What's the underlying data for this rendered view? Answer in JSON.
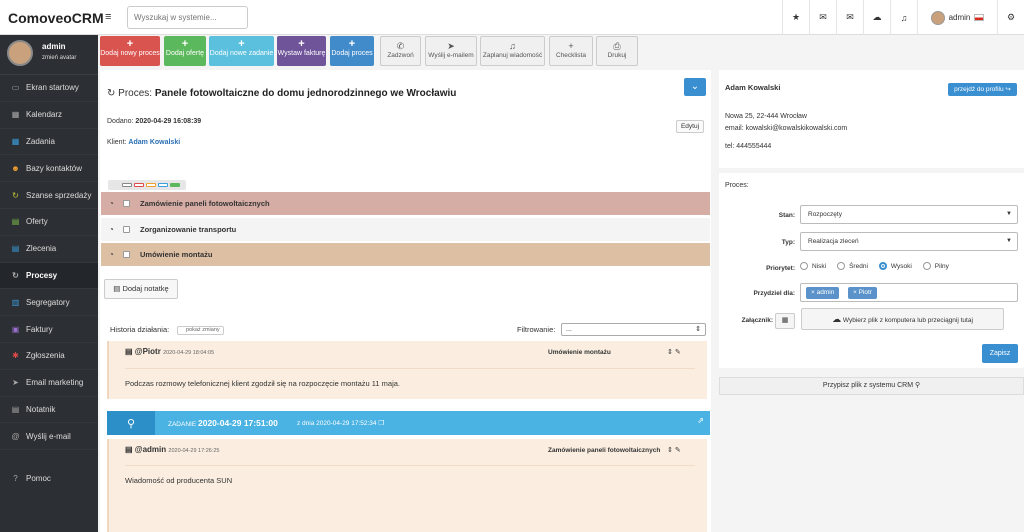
{
  "app": {
    "title": "ComoveoCRM",
    "menu_icon": "hamburger-icon"
  },
  "search": {
    "placeholder": "Wyszukaj w systemie..."
  },
  "topbar": {
    "icons": [
      "star-icon",
      "chat-icon",
      "mail-icon",
      "cloud-icon",
      "bell-icon"
    ],
    "user": "admin",
    "settings_icon": "gears-icon"
  },
  "sidebar": {
    "user_name": "admin",
    "change_avatar": "zmień avatar",
    "items": [
      {
        "label": "Ekran startowy",
        "icon": "monitor-icon",
        "glyph": "▭",
        "color": "w"
      },
      {
        "label": "Kalendarz",
        "icon": "calendar-icon",
        "glyph": "▦",
        "color": "w"
      },
      {
        "label": "Zadania",
        "icon": "tasks-icon",
        "glyph": "▦",
        "color": "b"
      },
      {
        "label": "Bazy kontaktów",
        "icon": "contacts-icon",
        "glyph": "☻",
        "color": "o"
      },
      {
        "label": "Szanse sprzedaży",
        "icon": "refresh-icon",
        "glyph": "↻",
        "color": "y"
      },
      {
        "label": "Oferty",
        "icon": "document-icon",
        "glyph": "▤",
        "color": "g"
      },
      {
        "label": "Zlecenia",
        "icon": "clipboard-icon",
        "glyph": "▤",
        "color": "b"
      },
      {
        "label": "Procesy",
        "icon": "process-icon",
        "glyph": "↻",
        "color": "w",
        "active": true
      },
      {
        "label": "Segregatory",
        "icon": "binder-icon",
        "glyph": "▥",
        "color": "b"
      },
      {
        "label": "Faktury",
        "icon": "invoice-icon",
        "glyph": "▣",
        "color": "p"
      },
      {
        "label": "Zgłoszenia",
        "icon": "ticket-icon",
        "glyph": "✱",
        "color": "r"
      },
      {
        "label": "Email marketing",
        "icon": "send-icon",
        "glyph": "➤",
        "color": "w"
      },
      {
        "label": "Notatnik",
        "icon": "notebook-icon",
        "glyph": "▤",
        "color": "w"
      },
      {
        "label": "Wyślij e-mail",
        "icon": "at-icon",
        "glyph": "@",
        "color": "w"
      }
    ],
    "help": "Pomoc"
  },
  "actions": {
    "colored": [
      {
        "label": "Dodaj nowy proces",
        "color": "#d9534f"
      },
      {
        "label": "Dodaj ofertę",
        "color": "#5cb85c"
      },
      {
        "label": "Dodaj nowe zadanie",
        "color": "#5bc0de"
      },
      {
        "label": "Wystaw fakturę",
        "color": "#6f5499"
      },
      {
        "label": "Dodaj proces",
        "color": "#428bca"
      }
    ],
    "gray": [
      {
        "label": "Zadzwoń",
        "icon": "phone-icon",
        "glyph": "✆"
      },
      {
        "label": "Wyślij e-mailem",
        "icon": "paper-plane-icon",
        "glyph": "➤"
      },
      {
        "label": "Zaplanuj wiadomość",
        "icon": "bell-icon",
        "glyph": "♫"
      },
      {
        "label": "Checklista",
        "icon": "plus-icon",
        "glyph": "+"
      },
      {
        "label": "Drukuj",
        "icon": "print-icon",
        "glyph": "⎙"
      }
    ]
  },
  "process": {
    "prefix": "Proces:",
    "name": "Panele fotowoltaiczne do domu jednorodzinnego we Wrocławiu",
    "added_label": "Dodano:",
    "added_value": "2020-04-29 16:08:39",
    "client_label": "Klient:",
    "client_name": "Adam Kowalski",
    "edit": "Edytuj",
    "tasks": [
      {
        "label": "Zamówienie paneli fotowoltaicznych",
        "bg": "#d6ada5"
      },
      {
        "label": "Zorganizowanie transportu",
        "bg": "#f4f4f4"
      },
      {
        "label": "Umówienie montażu",
        "bg": "#ddbfa4"
      }
    ],
    "add_note": "Dodaj notatkę"
  },
  "history": {
    "label": "Historia działania:",
    "show_changes": "pokaż zmiany",
    "filter_label": "Filtrowanie:",
    "filter_value": "...",
    "entries": [
      {
        "author": "@Piotr",
        "time": "2020-04-29 18:04:05",
        "task": "Umówienie montażu",
        "text": "Podczas rozmowy telefonicznej klient zgodził się na rozpoczęcie montażu 11 maja."
      },
      {
        "author": "@admin",
        "time": "2020-04-29 17:26:25",
        "task": "Zamówienie paneli fotowoltaicznych",
        "text": "Wiadomość od producenta SUN"
      }
    ],
    "task_bar": {
      "prefix": "ZADANIE",
      "datetime": "2020-04-29 17:51:00",
      "from": "z dnia 2020-04-29 17:52:34"
    }
  },
  "contact": {
    "name": "Adam Kowalski",
    "profile_btn": "przejdź do profilu",
    "address": "Nowa 25, 22-444 Wrocław",
    "email": "email: kowalski@kowalskikowalski.com",
    "phone": "tel: 444555444"
  },
  "process_form": {
    "title": "Proces:",
    "status_label": "Stan:",
    "status_value": "Rozpoczęty",
    "type_label": "Typ:",
    "type_value": "Realizacja zleceń",
    "priority_label": "Priorytet:",
    "priorities": [
      {
        "label": "Niski"
      },
      {
        "label": "Średni"
      },
      {
        "label": "Wysoki",
        "selected": true
      },
      {
        "label": "Pilny"
      }
    ],
    "assign_label": "Przydziel dla:",
    "assignees": [
      "× admin",
      "× Piotr"
    ],
    "attachment_label": "Załącznik:",
    "upload_text": "Wybierz plik z komputera  lub  przeciągnij tutaj",
    "save": "Zapisz",
    "attach_crm": "Przypisz plik z systemu CRM"
  }
}
